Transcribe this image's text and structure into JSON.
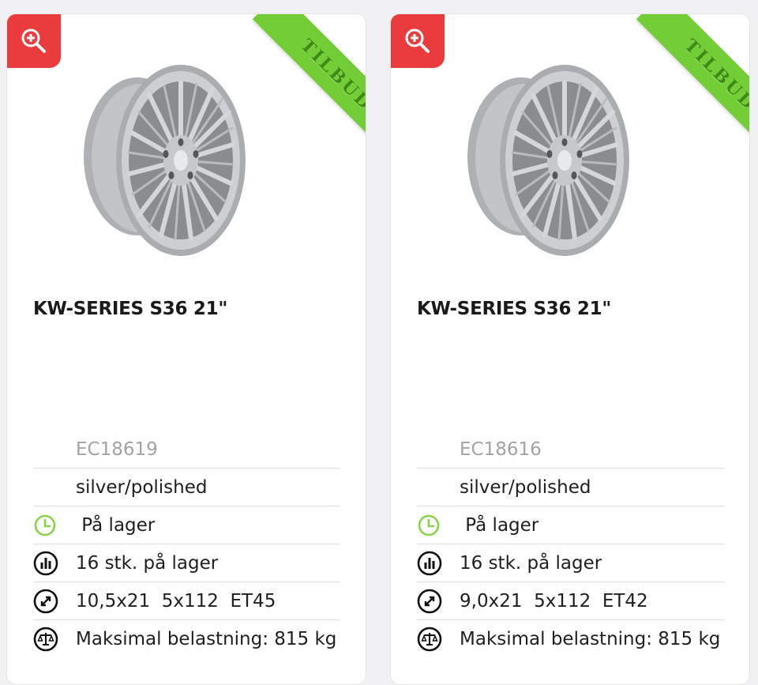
{
  "cards": [
    {
      "zoom_icon": "zoom-in-icon",
      "ribbon": "TILBUD",
      "title": "KW-SERIES S36 21\"",
      "code": "EC18619",
      "finish": "silver/polished",
      "availability": " På lager",
      "stock": "16 stk. på lager",
      "dimensions": "10,5x21  5x112  ET45",
      "max_load": "Maksimal belastning: 815 kg"
    },
    {
      "zoom_icon": "zoom-in-icon",
      "ribbon": "TILBUD",
      "title": "KW-SERIES S36 21\"",
      "code": "EC18616",
      "finish": "silver/polished",
      "availability": " På lager",
      "stock": "16 stk. på lager",
      "dimensions": "9,0x21  5x112  ET42",
      "max_load": "Maksimal belastning: 815 kg"
    }
  ],
  "colors": {
    "zoom_red": "#ea3c3c",
    "ribbon_green": "#72cd36",
    "stock_green": "#8bd24a",
    "code_grey": "#a3a3a3"
  },
  "icons": {
    "availability": "clock-icon",
    "stock": "bar-chart-icon",
    "dimensions": "resize-arrows-icon",
    "max_load": "scale-icon"
  }
}
